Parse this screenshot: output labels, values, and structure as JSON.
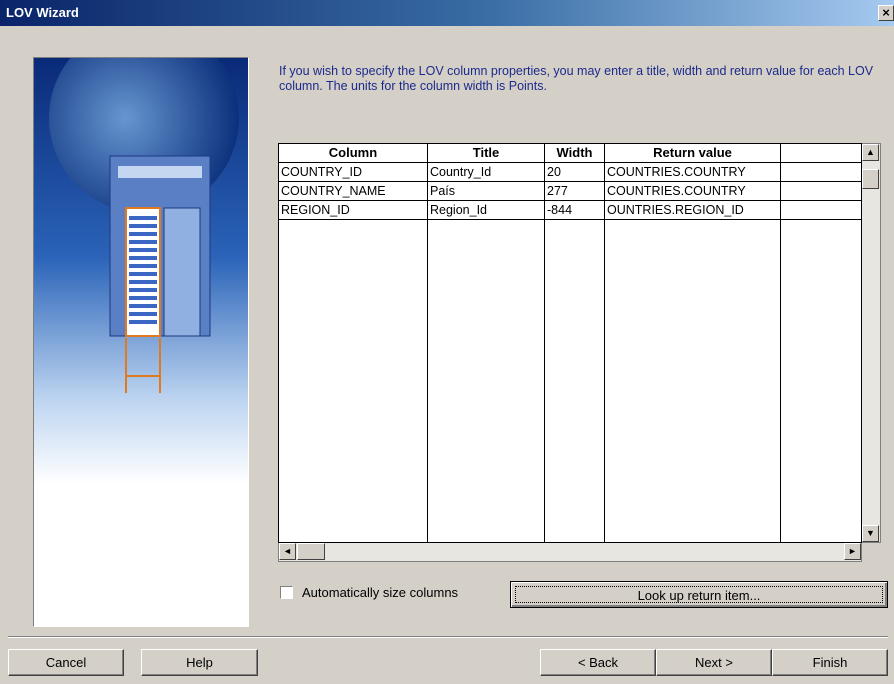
{
  "window": {
    "title": "LOV Wizard",
    "close_glyph": "×"
  },
  "instructions": "If you wish to specify the LOV column properties, you may enter a title, width and return value for each LOV column. The units for the column width is Points.",
  "grid": {
    "headers": [
      "Column",
      "Title",
      "Width",
      "Return value",
      ""
    ],
    "rows": [
      {
        "column": "COUNTRY_ID",
        "title": "Country_Id",
        "width": "20",
        "return_value": "COUNTRIES.COUNTRY"
      },
      {
        "column": "COUNTRY_NAME",
        "title": "País",
        "width": "277",
        "return_value": "COUNTRIES.COUNTRY"
      },
      {
        "column": "REGION_ID",
        "title": "Region_Id",
        "width": "-844",
        "return_value": "OUNTRIES.REGION_ID"
      }
    ]
  },
  "scroll": {
    "up": "▲",
    "down": "▼",
    "left": "◄",
    "right": "►"
  },
  "auto_size": {
    "label": "Automatically size columns",
    "checked": false
  },
  "lookup_button": "Look up return item...",
  "buttons": {
    "cancel": "Cancel",
    "help": "Help",
    "back": "< Back",
    "next": "Next >",
    "finish": "Finish"
  },
  "icons": {
    "close": "close-icon",
    "illustration": "wizard-illustration"
  }
}
